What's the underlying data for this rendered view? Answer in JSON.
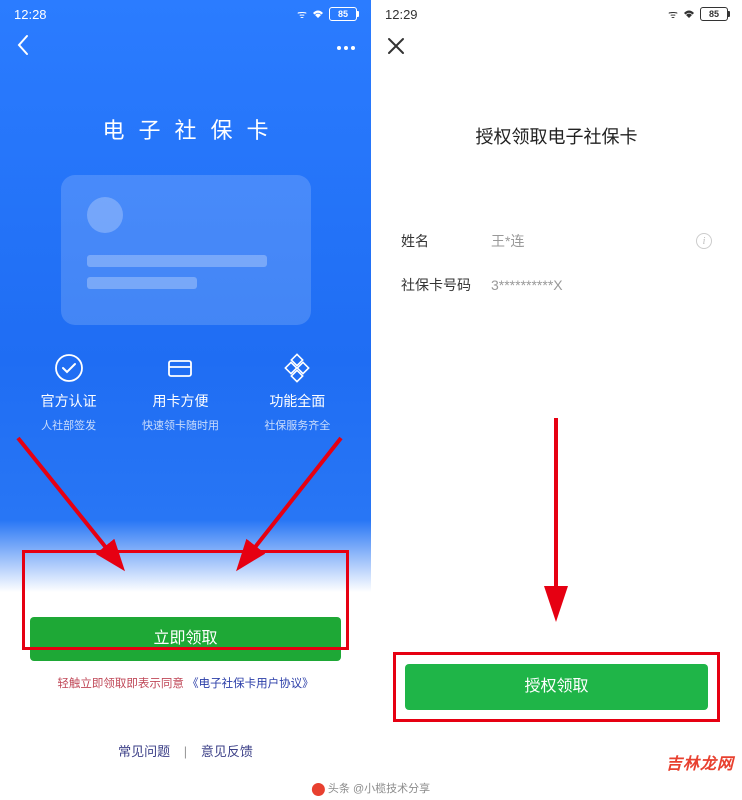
{
  "left": {
    "status": {
      "time": "12:28",
      "battery": "85"
    },
    "title": "电子社保卡",
    "features": [
      {
        "icon": "check-circle",
        "title": "官方认证",
        "sub": "人社部签发"
      },
      {
        "icon": "card",
        "title": "用卡方便",
        "sub": "快速领卡随时用"
      },
      {
        "icon": "diamond",
        "title": "功能全面",
        "sub": "社保服务齐全"
      }
    ],
    "btn": "立即领取",
    "agreement_prefix": "轻触立即领取即表示同意 ",
    "agreement_link": "《电子社保卡用户协议》",
    "footer": {
      "faq": "常见问题",
      "feedback": "意见反馈"
    }
  },
  "right": {
    "status": {
      "time": "12:29",
      "battery": "85"
    },
    "title": "授权领取电子社保卡",
    "fields": {
      "name_label": "姓名",
      "name_value": "王*连",
      "card_label": "社保卡号码",
      "card_value": "3**********X"
    },
    "btn": "授权领取"
  },
  "watermark": "吉林龙网",
  "attribution": "头条 @小榄技术分享"
}
